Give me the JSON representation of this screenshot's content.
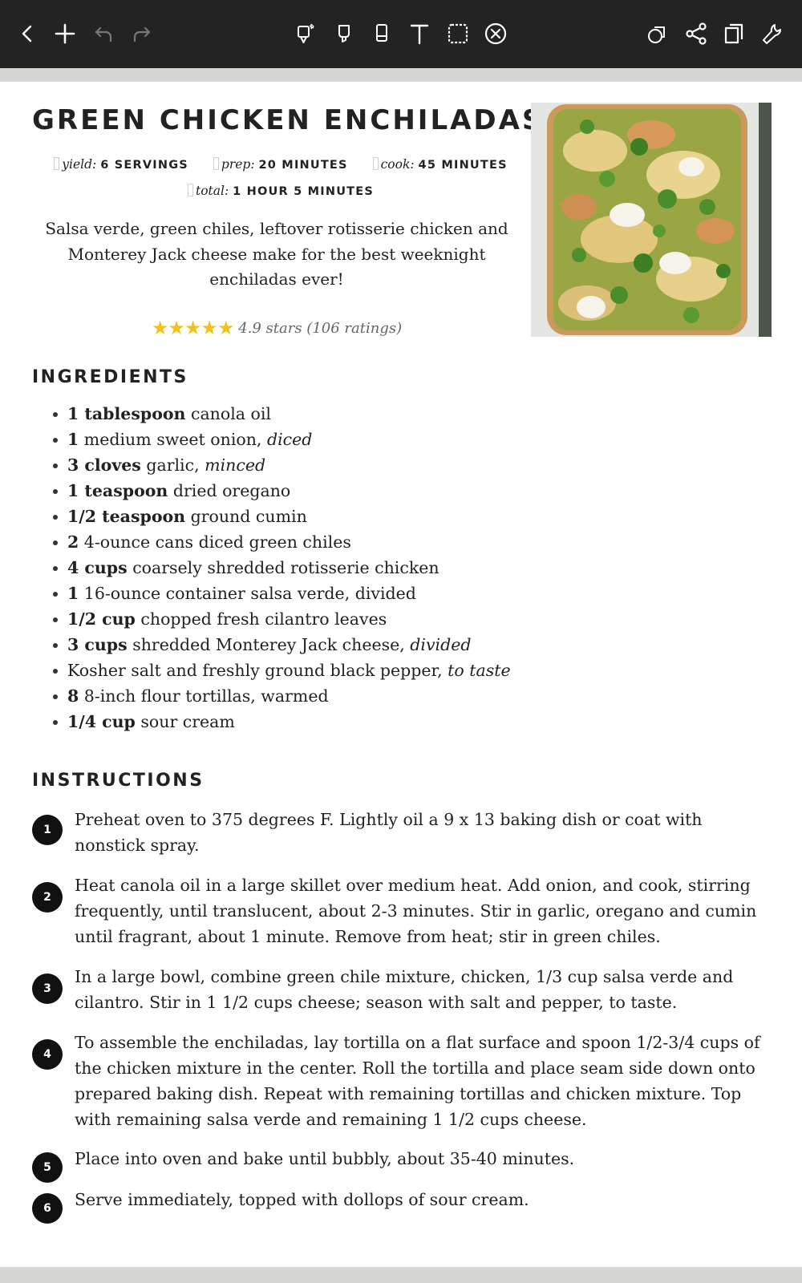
{
  "toolbar": {
    "left_icons": [
      "back-icon",
      "add-icon",
      "undo-icon",
      "redo-icon"
    ],
    "center_icons": [
      "pen-bluetooth-icon",
      "highlighter-icon",
      "eraser-icon",
      "text-tool-icon",
      "lasso-select-icon",
      "clear-icon"
    ],
    "right_icons": [
      "view-mode-icon",
      "share-icon",
      "pages-icon",
      "settings-icon"
    ],
    "bg": "#232323"
  },
  "recipe": {
    "title": "GREEN CHICKEN ENCHILADAS",
    "yield_label": "yield:",
    "yield_value": "6 SERVINGS",
    "prep_label": "prep:",
    "prep_value": "20 MINUTES",
    "cook_label": "cook:",
    "cook_value": "45 MINUTES",
    "total_label": "total:",
    "total_value": "1 HOUR 5 MINUTES",
    "description": "Salsa verde, green chiles, leftover rotisserie chicken and Monterey Jack cheese make for the best weeknight enchiladas ever!",
    "stars": "★★★★★",
    "rating_value": 4.9,
    "rating_text": "4.9 stars (106 ratings)"
  },
  "ingredients": {
    "heading": "INGREDIENTS",
    "items": [
      {
        "qty": "1 tablespoon",
        "text": " canola oil",
        "note": ""
      },
      {
        "qty": "1",
        "text": " medium sweet onion, ",
        "note": "diced"
      },
      {
        "qty": "3 cloves",
        "text": " garlic, ",
        "note": "minced"
      },
      {
        "qty": "1 teaspoon",
        "text": " dried oregano",
        "note": ""
      },
      {
        "qty": "1/2 teaspoon",
        "text": " ground cumin",
        "note": ""
      },
      {
        "qty": "2",
        "text": " 4-ounce cans diced green chiles",
        "note": ""
      },
      {
        "qty": "4 cups",
        "text": " coarsely shredded rotisserie chicken",
        "note": ""
      },
      {
        "qty": "1",
        "text": " 16-ounce container salsa verde, divided",
        "note": ""
      },
      {
        "qty": "1/2 cup",
        "text": " chopped fresh cilantro leaves",
        "note": ""
      },
      {
        "qty": "3 cups",
        "text": " shredded Monterey Jack cheese, ",
        "note": "divided"
      },
      {
        "qty": "",
        "text": "Kosher salt and freshly ground black pepper, ",
        "note": "to taste"
      },
      {
        "qty": "8",
        "text": " 8-inch flour tortillas, warmed",
        "note": ""
      },
      {
        "qty": "1/4 cup",
        "text": " sour cream",
        "note": ""
      }
    ]
  },
  "instructions": {
    "heading": "INSTRUCTIONS",
    "steps": [
      {
        "num": "1",
        "text": "Preheat oven to 375 degrees F. Lightly oil a 9 x 13 baking dish or coat with nonstick spray."
      },
      {
        "num": "2",
        "text": "Heat canola oil in a large skillet over medium heat. Add onion, and cook, stirring frequently, until translucent, about 2-3 minutes. Stir in garlic, oregano and cumin until fragrant, about 1 minute. Remove from heat; stir in green chiles."
      },
      {
        "num": "3",
        "text": "In a large bowl, combine green chile mixture, chicken, 1/3 cup salsa verde and cilantro. Stir in 1 1/2 cups cheese; season with salt and pepper, to taste."
      },
      {
        "num": "4",
        "text": "To assemble the enchiladas, lay tortilla on a flat surface and spoon 1/2-3/4 cups of the chicken mixture in the center. Roll the tortilla and place seam side down onto prepared baking dish. Repeat with remaining tortillas and chicken mixture. Top with remaining salsa verde and remaining 1 1/2 cups cheese."
      },
      {
        "num": "5",
        "text": "Place into oven and bake until bubbly, about 35-40 minutes."
      },
      {
        "num": "6",
        "text": "Serve immediately, topped with dollops of sour cream."
      }
    ]
  }
}
